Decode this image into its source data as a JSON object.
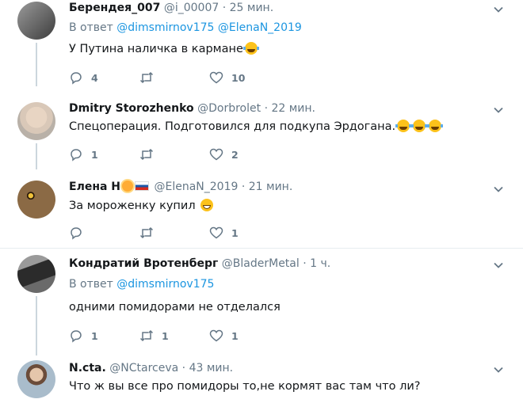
{
  "tweets": [
    {
      "name": "Берендея_007",
      "handle": "@i_00007",
      "time": "25 мин.",
      "reply_prefix": "В ответ",
      "reply_mentions": "@dimsmirnov175 @ElenaN_2019",
      "text": "У Путина наличка в кармане",
      "emojis": [
        "face-with-tears-of-joy"
      ],
      "reply_count": "4",
      "retweet_count": "",
      "like_count": "10",
      "avatar_color": "#6f6f6f"
    },
    {
      "name": "Dmitry Storozhenko",
      "handle": "@Dorbrolet",
      "time": "22 мин.",
      "text": "Спецоперация. Подготовился для подкупа Эрдогана.",
      "emojis": [
        "face-with-tears-of-joy",
        "face-with-tears-of-joy",
        "face-with-tears-of-joy"
      ],
      "reply_count": "1",
      "retweet_count": "",
      "like_count": "2",
      "avatar_color": "#c9b6a4"
    },
    {
      "name": "Елена Н",
      "handle": "@ElenaN_2019",
      "time": "21 мин.",
      "text": "За мороженку купил",
      "emojis": [
        "grinning-face"
      ],
      "name_emojis": [
        "sun-icon",
        "russia-flag-icon"
      ],
      "reply_count": "",
      "retweet_count": "",
      "like_count": "1",
      "avatar_color": "#7a5a38"
    },
    {
      "name": "Кондратий Вротенберг",
      "handle": "@BladerMetal",
      "time": "1 ч.",
      "reply_prefix": "В ответ",
      "reply_mentions": "@dimsmirnov175",
      "text": "одними помидорами не отделался",
      "reply_count": "1",
      "retweet_count": "1",
      "like_count": "1",
      "avatar_color": "#4a4a4a"
    },
    {
      "name": "N.cta.",
      "handle": "@NCtarceva",
      "time": "43 мин.",
      "text": "Что ж вы все про помидоры то,не кормят вас там что ли?",
      "avatar_color": "#8aa0b0"
    }
  ],
  "separator": "·",
  "colors": {
    "link": "#1b95e0",
    "muted": "#657786",
    "thread_line": "#ccd6dd",
    "divider": "#e6ecf0"
  }
}
